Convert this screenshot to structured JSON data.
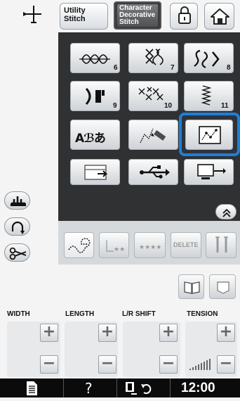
{
  "top": {
    "utility_label": "Utility\nStitch",
    "character_label": "Character\nDecorative\nStitch"
  },
  "grid": {
    "numbers": [
      "6",
      "7",
      "8",
      "9",
      "10",
      "11"
    ],
    "letters": "Aℬあ"
  },
  "tools": {
    "delete_label": "DELETE"
  },
  "controls": {
    "width_label": "WIDTH",
    "length_label": "LENGTH",
    "shift_label": "L/R SHIFT",
    "tension_label": "TENSION",
    "plus": "+",
    "minus": "−"
  },
  "status": {
    "help": "?",
    "time": "12:00"
  },
  "colors": {
    "highlight": "#1e7fd6",
    "panel": "#2f3133",
    "status_bar": "#0b0b0b"
  }
}
